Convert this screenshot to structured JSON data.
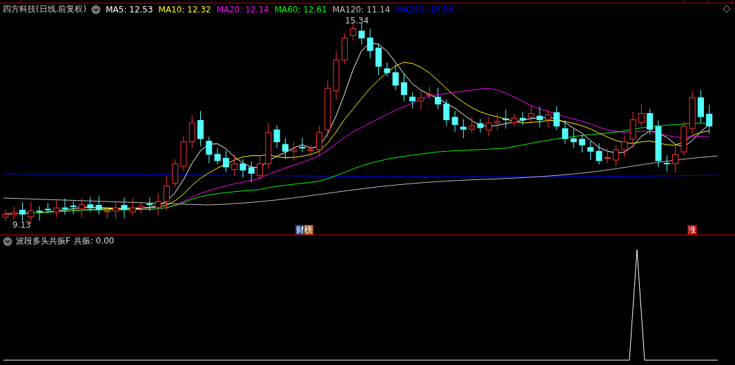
{
  "chart": {
    "title": "四方科技(日线.前复权)",
    "ma": [
      {
        "label": "MA5: 12.53",
        "color": "#ffffff"
      },
      {
        "label": "MA10: 12.32",
        "color": "#ffff00"
      },
      {
        "label": "MA20: 12.14",
        "color": "#ff00ff"
      },
      {
        "label": "MA60: 12.61",
        "color": "#00ff00"
      },
      {
        "label": "MA120: 11.14",
        "color": "#c0c0c0"
      },
      {
        "label": "MA250: 10.56",
        "color": "#0000ff"
      }
    ],
    "high_label": "15.34",
    "low_label": "9.13",
    "badges": [
      {
        "text": "财榜",
        "kind": "finance"
      },
      {
        "text": "涨",
        "kind": "rise"
      }
    ]
  },
  "indicator": {
    "title": "波段多头共振F",
    "reading": "共振: 0.00"
  }
}
